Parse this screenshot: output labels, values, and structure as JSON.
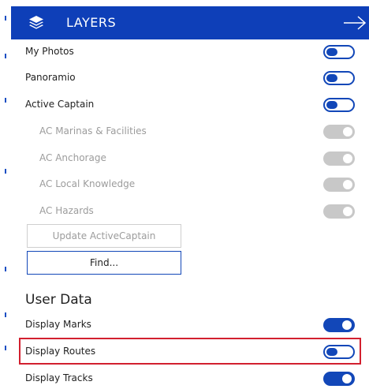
{
  "header": {
    "title": "LAYERS",
    "icon": "layers-icon",
    "nav_icon": "arrow-right-icon",
    "color": "#0e3fb8"
  },
  "layers": [
    {
      "label": "My Photos",
      "state": "off"
    },
    {
      "label": "Panoramio",
      "state": "off"
    },
    {
      "label": "Active Captain",
      "state": "off"
    },
    {
      "label": "AC Marinas & Facilities",
      "state": "disabled",
      "sub": true
    },
    {
      "label": "AC Anchorage",
      "state": "disabled",
      "sub": true
    },
    {
      "label": "AC Local Knowledge",
      "state": "disabled",
      "sub": true
    },
    {
      "label": "AC Hazards",
      "state": "disabled",
      "sub": true
    }
  ],
  "buttons": {
    "update_label": "Update ActiveCaptain",
    "find_label": "Find..."
  },
  "user_data": {
    "title": "User Data",
    "items": [
      {
        "label": "Display Marks",
        "state": "on"
      },
      {
        "label": "Display Routes",
        "state": "off",
        "highlighted": true
      },
      {
        "label": "Display Tracks",
        "state": "on"
      }
    ]
  },
  "colors": {
    "accent": "#1247b8",
    "highlight": "#d2202f",
    "disabled": "#c8c8c8"
  }
}
